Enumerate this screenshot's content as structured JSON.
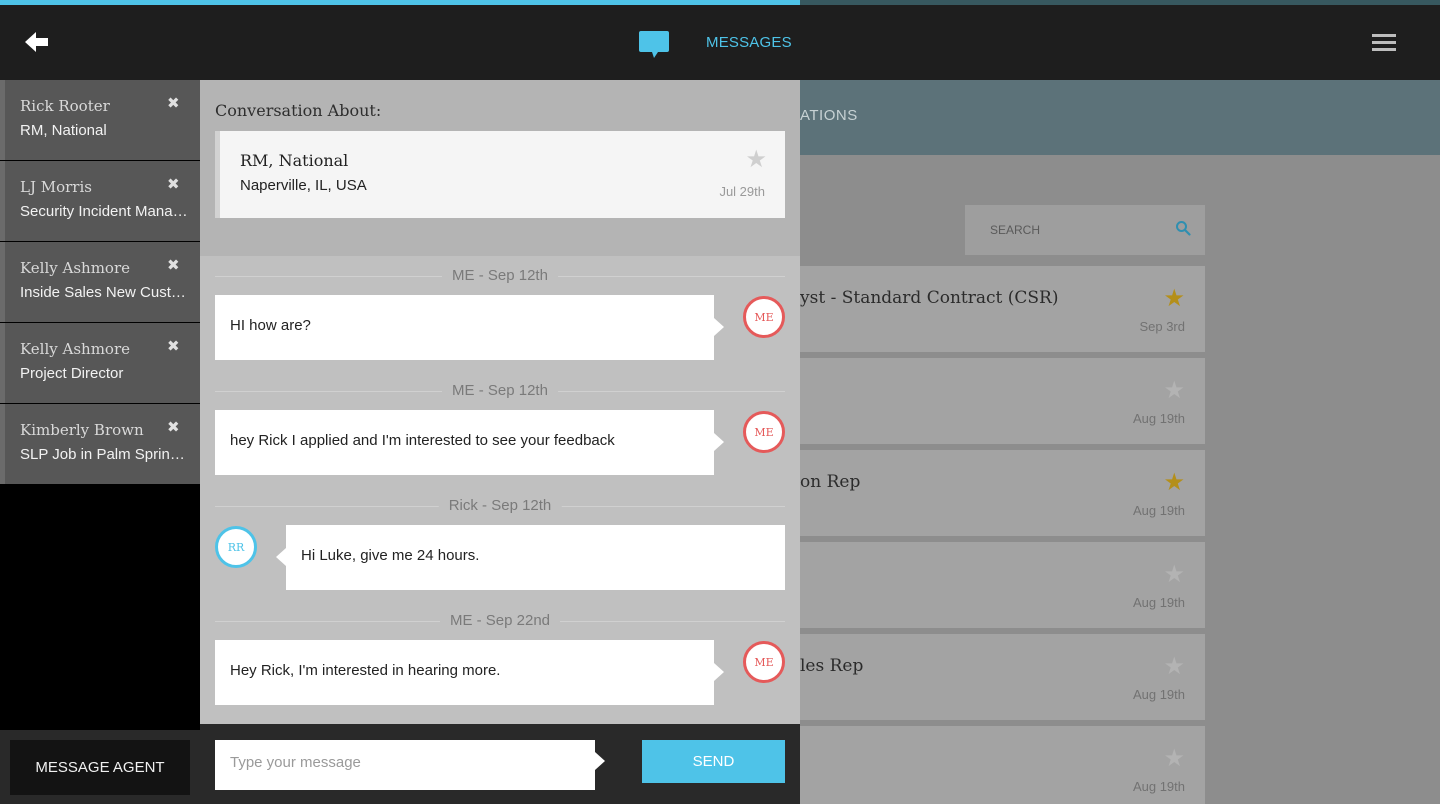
{
  "header": {
    "title": "MESSAGES",
    "back_icon": "arrow-left-icon",
    "messages_icon": "chat-bubble-icon",
    "accent_color": "#4ec3e8"
  },
  "contacts": [
    {
      "name": "Rick Rooter",
      "subtitle": "RM, National"
    },
    {
      "name": "LJ Morris",
      "subtitle": "Security Incident Management Specialist"
    },
    {
      "name": "Kelly Ashmore",
      "subtitle": "Inside Sales New Customer Acquisition"
    },
    {
      "name": "Kelly Ashmore",
      "subtitle": "Project Director"
    },
    {
      "name": "Kimberly Brown",
      "subtitle": "SLP Job in Palm Springs, CA"
    }
  ],
  "message_agent_label": "MESSAGE AGENT",
  "conversation": {
    "about_label": "Conversation About:",
    "job": {
      "title": "RM, National",
      "location": "Naperville, IL, USA",
      "date": "Jul 29th",
      "starred": false
    },
    "messages": [
      {
        "meta": "ME - Sep 12th",
        "text": "HI how are?",
        "from": "me",
        "avatar": "ME"
      },
      {
        "meta": "ME - Sep 12th",
        "text": "hey Rick I applied and I'm interested to see your feedback",
        "from": "me",
        "avatar": "ME"
      },
      {
        "meta": "Rick - Sep 12th",
        "text": "Hi Luke, give me 24 hours.",
        "from": "them",
        "avatar": "RR"
      },
      {
        "meta": "ME - Sep 22nd",
        "text": "Hey Rick, I'm interested in hearing more.",
        "from": "me",
        "avatar": "ME"
      }
    ]
  },
  "composer": {
    "placeholder": "Type your message",
    "send_label": "SEND"
  },
  "background": {
    "tab_fragment": "ATIONS",
    "search_placeholder": "SEARCH",
    "cards": [
      {
        "title": "yst - Standard Contract (CSR)",
        "date": "Sep 3rd",
        "starred": true
      },
      {
        "title": "",
        "date": "Aug 19th",
        "starred": false
      },
      {
        "title": "on Rep",
        "date": "Aug 19th",
        "starred": true
      },
      {
        "title": "",
        "date": "Aug 19th",
        "starred": false
      },
      {
        "title": "les Rep",
        "date": "Aug 19th",
        "starred": false
      },
      {
        "title": "",
        "date": "Aug 19th",
        "starred": false
      }
    ]
  }
}
